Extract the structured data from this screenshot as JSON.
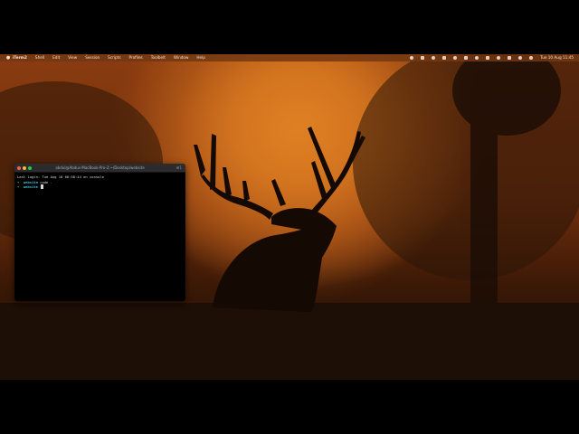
{
  "menubar": {
    "items": [
      {
        "label": "iTerm2",
        "bold": true
      },
      {
        "label": "Shell"
      },
      {
        "label": "Edit"
      },
      {
        "label": "View"
      },
      {
        "label": "Session"
      },
      {
        "label": "Scripts"
      },
      {
        "label": "Profiles"
      },
      {
        "label": "Toolbelt"
      },
      {
        "label": "Window"
      },
      {
        "label": "Help"
      }
    ],
    "clock": "Tue 10 Aug  11:45"
  },
  "terminal": {
    "title": "abdul@Abdus-MacBook-Pro-2:~/Desktop/website",
    "shortcut": "⌘1",
    "last_login": "Last login: Tue Aug 10 08:58:44 on console",
    "line1": {
      "prompt": "➜",
      "dir": "website",
      "command": "code ."
    },
    "line2": {
      "prompt": "➜",
      "dir": "website",
      "command": ""
    }
  },
  "colors": {
    "accent_orange": "#c5651a",
    "prompt_green": "#3ad36a",
    "dir_cyan": "#3ec6e0"
  }
}
